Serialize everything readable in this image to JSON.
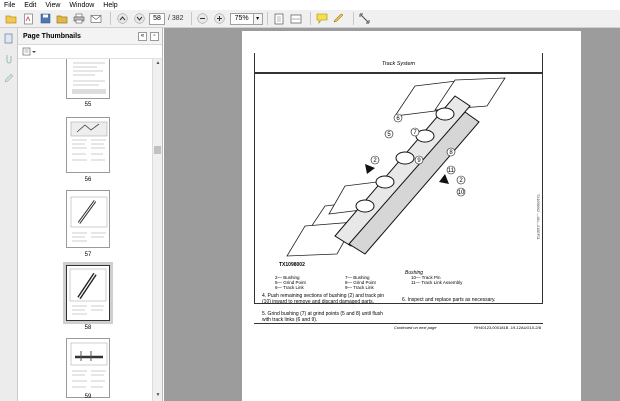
{
  "menu": [
    "File",
    "Edit",
    "View",
    "Window",
    "Help"
  ],
  "toolbar": {
    "page_current": "58",
    "page_total": "/ 382",
    "zoom": "75%"
  },
  "panel": {
    "title": "Page Thumbnails",
    "thumbnails": [
      {
        "label": "55"
      },
      {
        "label": "56"
      },
      {
        "label": "57"
      },
      {
        "label": "58",
        "selected": true
      },
      {
        "label": "59"
      }
    ]
  },
  "document": {
    "header": "Track System",
    "figure_id": "TX1098002",
    "figure_caption": "Bushing",
    "callouts": [
      "6",
      "5",
      "7",
      "2",
      "8",
      "9",
      "2",
      "11",
      "10"
    ],
    "legend": [
      [
        "2— Bushing",
        "7— Bushing",
        "10— Track Pin"
      ],
      [
        "5— Grind Point",
        "8— Grind Point",
        "11— Track Link Assembly"
      ],
      [
        "6— Track Link",
        "9— Track Link",
        ""
      ]
    ],
    "step4": "4.  Push remaining sections of bushing (2) and track pin (10) inward to remove and discard damaged parts.",
    "step5": "5.  Grind bushing (7) at grind points (5 and 8) until flush with track links (6 and 9).",
    "step6": "6.  Inspect and replace parts as necessary.",
    "continued": "Continued on next page",
    "ref": "RH40123,000181B -19-12AUG10-2/8",
    "side_ref": "TX1098002 —UN—21SEP11"
  }
}
